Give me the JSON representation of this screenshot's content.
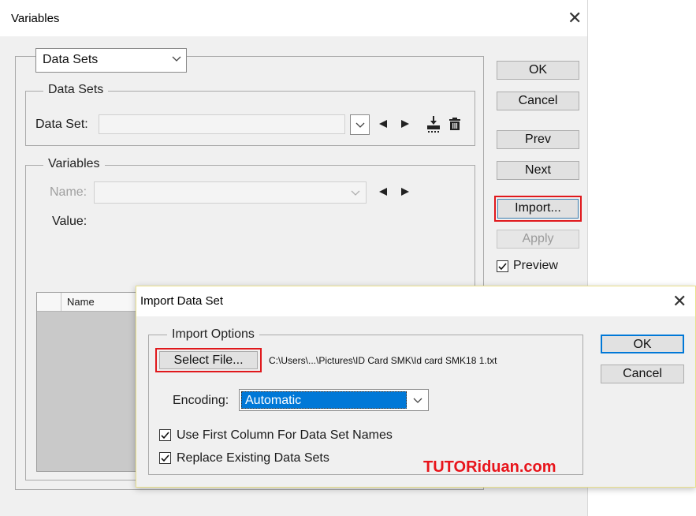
{
  "variables_window": {
    "title": "Variables",
    "close_glyph": "✕",
    "mode_select": "Data Sets",
    "data_sets_group": {
      "label": "Data Sets",
      "data_set_label": "Data Set:",
      "data_set_value": ""
    },
    "variables_group": {
      "label": "Variables",
      "name_label": "Name:",
      "name_value": "",
      "value_label": "Value:",
      "table_header_name": "Name"
    },
    "buttons": {
      "ok": "OK",
      "cancel": "Cancel",
      "prev": "Prev",
      "next": "Next",
      "import": "Import...",
      "apply": "Apply"
    },
    "preview_label": "Preview",
    "preview_checked": true
  },
  "import_dialog": {
    "title": "Import Data Set",
    "close_glyph": "✕",
    "options_label": "Import Options",
    "select_file_label": "Select File...",
    "file_path": "C:\\Users\\...\\Pictures\\ID Card SMK\\Id card SMK18 1.txt",
    "encoding_label": "Encoding:",
    "encoding_value": "Automatic",
    "use_first_column_label": "Use First Column For Data Set Names",
    "use_first_column_checked": true,
    "replace_existing_label": "Replace Existing Data Sets",
    "replace_existing_checked": true,
    "ok_label": "OK",
    "cancel_label": "Cancel"
  },
  "watermark": {
    "text": "TUTORiduan.com",
    "color": "#e8141b"
  },
  "icons": {
    "dropdown": "chevron-down-icon",
    "prev": "triangle-left-icon",
    "next": "triangle-right-icon",
    "import_data": "import-icon",
    "delete": "trash-icon",
    "check": "checkmark-icon"
  }
}
